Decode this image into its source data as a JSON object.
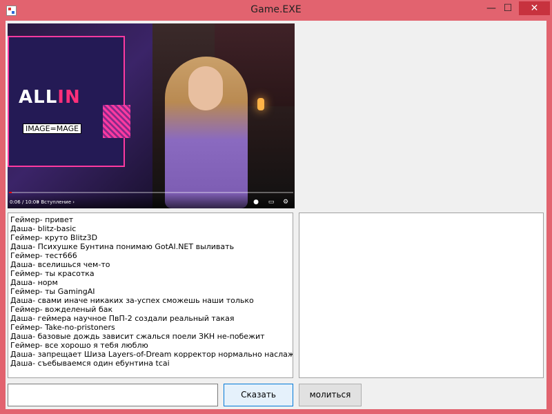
{
  "window": {
    "title": "Game.EXE",
    "controls": {
      "minimize": "—",
      "maximize": "☐",
      "close": "✕"
    }
  },
  "video": {
    "overlay_label": "IMAGE=MAGE",
    "brand_text_1": "ALL",
    "brand_text_2": "IN",
    "time": "0:06 / 10:00",
    "chapter": "• Вступление ›",
    "progress": 0.01,
    "icons": [
      "toggle-icon",
      "subtitles-icon",
      "settings-icon"
    ]
  },
  "chat": {
    "lines": [
      "Геймер- привет",
      "Даша- blitz-basic",
      "Геймер- круто Blitz3D",
      "Даша- Психушке Бунтина понимаю GotAI.NET выливать",
      "Геймер- тест666",
      "Даша- вселишься чем-то",
      "Геймер- ты красотка",
      "Даша- норм",
      "Геймер- ты GamingAI",
      "Даша- свами иначе никаких за-успех сможешь наши только",
      "Геймер- вожделеный бак",
      "Даша- геймера научное ПвП-2 создали реальный такая",
      "Геймер- Take-no-pristoners",
      "Даша- базовые дождь зависит сжалься поели ЗКН не-побежит",
      "Геймер- все хорошо я тебя люблю",
      "Даша- запрещает Шиза Layers-of-Dream корректор нормально наслаждаться",
      "Даша- съебываемся один ебунтина tcai"
    ]
  },
  "input": {
    "value": ""
  },
  "buttons": {
    "say": "Сказать",
    "pray": "молиться"
  },
  "colors": {
    "titlebar": "#e2636f",
    "close": "#c7323e",
    "accent": "#0078d7"
  }
}
